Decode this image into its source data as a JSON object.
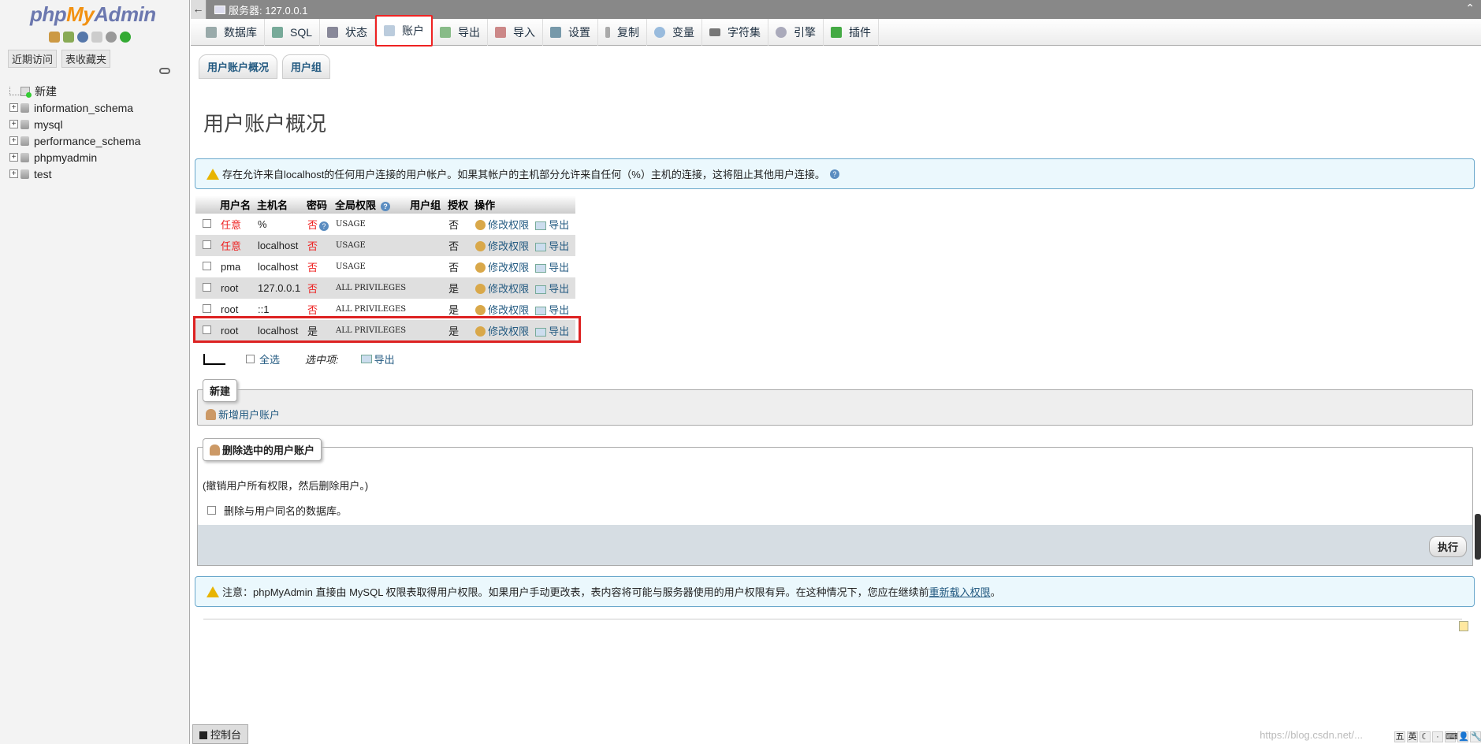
{
  "sidebar": {
    "logo_php": "php",
    "logo_my": "My",
    "logo_admin": "Admin",
    "tabs": [
      "近期访问",
      "表收藏夹"
    ],
    "tree": [
      {
        "label": "新建"
      },
      {
        "label": "information_schema"
      },
      {
        "label": "mysql"
      },
      {
        "label": "performance_schema"
      },
      {
        "label": "phpmyadmin"
      },
      {
        "label": "test"
      }
    ]
  },
  "topbar": {
    "back": "←",
    "server": "服务器: 127.0.0.1"
  },
  "tabs": [
    {
      "label": "数据库",
      "icon": "database-icon"
    },
    {
      "label": "SQL",
      "icon": "sql-icon"
    },
    {
      "label": "状态",
      "icon": "status-icon"
    },
    {
      "label": "账户",
      "icon": "accounts-icon",
      "active": true
    },
    {
      "label": "导出",
      "icon": "export-icon"
    },
    {
      "label": "导入",
      "icon": "import-icon"
    },
    {
      "label": "设置",
      "icon": "settings-icon"
    },
    {
      "label": "复制",
      "icon": "replication-icon"
    },
    {
      "label": "变量",
      "icon": "variables-icon"
    },
    {
      "label": "字符集",
      "icon": "charset-icon"
    },
    {
      "label": "引擎",
      "icon": "engine-icon"
    },
    {
      "label": "插件",
      "icon": "plugin-icon"
    }
  ],
  "subtabs": [
    "用户账户概况",
    "用户组"
  ],
  "page_title": "用户账户概况",
  "notice_top": "存在允许来自localhost的任何用户连接的用户帐户。如果其帐户的主机部分允许来自任何（%）主机的连接，这将阻止其他用户连接。",
  "table": {
    "headers": [
      "用户名",
      "主机名",
      "密码",
      "全局权限",
      "用户组",
      "授权",
      "操作"
    ],
    "rows": [
      {
        "user": "任意",
        "host": "%",
        "pwd": "否",
        "priv": "USAGE",
        "grant": "否",
        "user_red": true,
        "pwd_q": true
      },
      {
        "user": "任意",
        "host": "localhost",
        "pwd": "否",
        "priv": "USAGE",
        "grant": "否",
        "user_red": true
      },
      {
        "user": "pma",
        "host": "localhost",
        "pwd": "否",
        "priv": "USAGE",
        "grant": "否"
      },
      {
        "user": "root",
        "host": "127.0.0.1",
        "pwd": "否",
        "priv": "ALL PRIVILEGES",
        "grant": "是"
      },
      {
        "user": "root",
        "host": "::1",
        "pwd": "否",
        "priv": "ALL PRIVILEGES",
        "grant": "是"
      },
      {
        "user": "root",
        "host": "localhost",
        "pwd": "是",
        "priv": "ALL PRIVILEGES",
        "grant": "是"
      }
    ],
    "edit_label": "修改权限",
    "export_label": "导出"
  },
  "bulk": {
    "select_all": "全选",
    "with_selected": "选中项:",
    "export": "导出"
  },
  "new_box": {
    "legend": "新建",
    "add_user": "新增用户账户"
  },
  "delete_box": {
    "legend": "删除选中的用户账户",
    "desc": "(撤销用户所有权限，然后删除用户。)",
    "drop_db": "删除与用户同名的数据库。",
    "execute": "执行"
  },
  "notice_bottom": {
    "prefix": "注意：phpMyAdmin 直接由 MySQL 权限表取得用户权限。如果用户手动更改表，表内容将可能与服务器使用的用户权限有异。在这种情况下，您应在继续前",
    "link": "重新载入权限",
    "suffix": "。"
  },
  "console": "控制台",
  "watermark": "https://blog.csdn.net/...",
  "tray": [
    "五",
    "英",
    "☾",
    "·",
    "⌨",
    "👤",
    "🔧"
  ]
}
